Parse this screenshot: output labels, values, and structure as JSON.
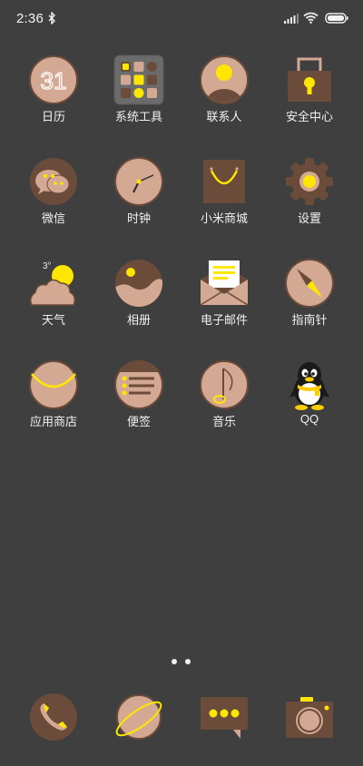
{
  "status_bar": {
    "time": "2:36",
    "icons": [
      "bluetooth-icon",
      "signal-icon",
      "wifi-icon",
      "battery-icon"
    ]
  },
  "colors": {
    "background": "#3f3f3f",
    "icon_tan": "#d4a993",
    "icon_brown": "#6b4b3a",
    "accent_yellow": "#ffe600"
  },
  "apps": [
    {
      "label": "日历",
      "icon": "calendar-icon",
      "calendar_number": "31"
    },
    {
      "label": "系统工具",
      "icon": "system-tools-folder-icon"
    },
    {
      "label": "联系人",
      "icon": "contacts-icon"
    },
    {
      "label": "安全中心",
      "icon": "security-center-icon"
    },
    {
      "label": "微信",
      "icon": "wechat-icon"
    },
    {
      "label": "时钟",
      "icon": "clock-icon"
    },
    {
      "label": "小米商城",
      "icon": "mi-store-icon"
    },
    {
      "label": "设置",
      "icon": "settings-gear-icon"
    },
    {
      "label": "天气",
      "icon": "weather-icon",
      "temperature": "3°"
    },
    {
      "label": "相册",
      "icon": "gallery-icon"
    },
    {
      "label": "电子邮件",
      "icon": "email-icon"
    },
    {
      "label": "指南针",
      "icon": "compass-icon"
    },
    {
      "label": "应用商店",
      "icon": "app-store-icon"
    },
    {
      "label": "便签",
      "icon": "notes-icon"
    },
    {
      "label": "音乐",
      "icon": "music-icon"
    },
    {
      "label": "QQ",
      "icon": "qq-penguin-icon"
    }
  ],
  "page_indicator": {
    "pages": 2,
    "current": 1
  },
  "dock": [
    {
      "icon": "phone-icon"
    },
    {
      "icon": "browser-planet-icon"
    },
    {
      "icon": "messages-icon"
    },
    {
      "icon": "camera-icon"
    }
  ]
}
